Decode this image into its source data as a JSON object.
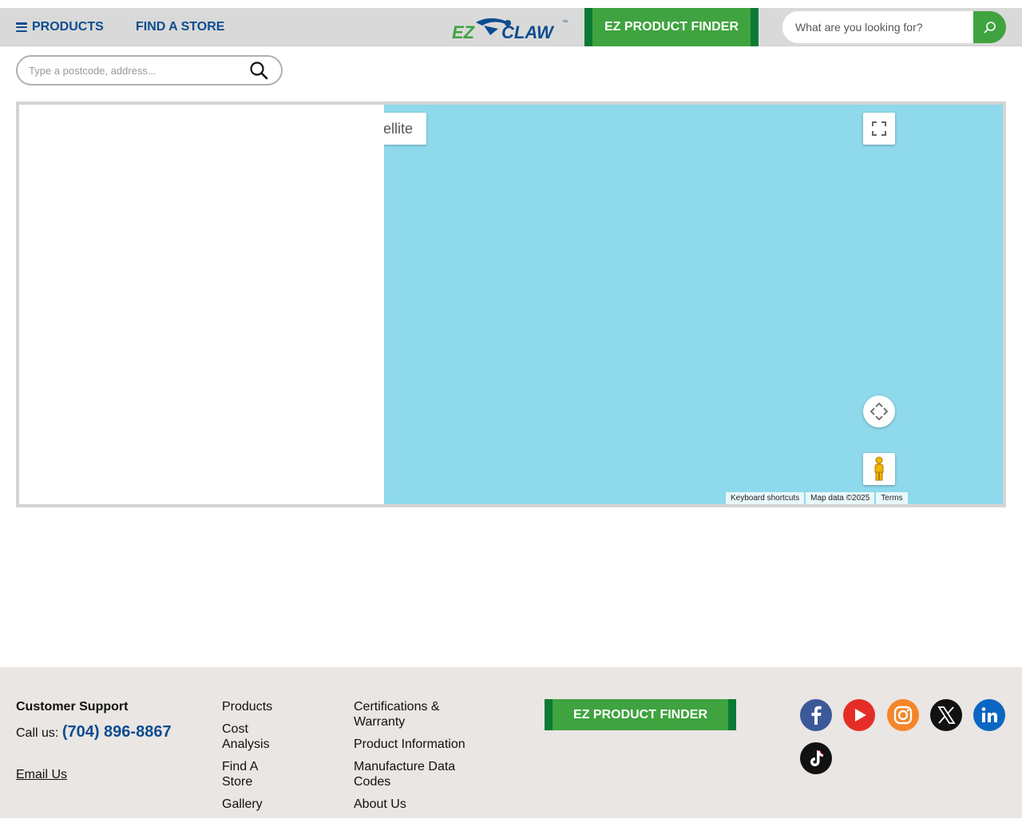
{
  "header": {
    "products_label": "PRODUCTS",
    "find_store_label": "FIND A STORE",
    "logo_ez": "EZ",
    "logo_claw": "CLAW",
    "logo_tm": "™",
    "finder_label": "EZ PRODUCT FINDER",
    "search_placeholder": "What are you looking for?"
  },
  "locator": {
    "search_placeholder": "Type a postcode, address..."
  },
  "map": {
    "map_type_label": "ellite",
    "attribution": {
      "shortcuts": "Keyboard shortcuts",
      "data": "Map data ©2025",
      "terms": "Terms"
    },
    "water_color": "#8fd9ec"
  },
  "footer": {
    "support_title": "Customer Support",
    "call_prefix": "Call us:",
    "phone": "(704) 896-8867",
    "email_label": "Email Us",
    "col1": [
      "Products",
      "Cost Analysis",
      "Find A Store",
      "Gallery"
    ],
    "col2": [
      "Certifications & Warranty",
      "Product Information",
      "Manufacture Data Codes",
      "About Us"
    ],
    "finder_label": "EZ PRODUCT FINDER",
    "social": [
      "facebook-icon",
      "youtube-icon",
      "instagram-icon",
      "x-twitter-icon",
      "linkedin-icon",
      "tiktok-icon"
    ]
  },
  "colors": {
    "brand_blue": "#0d4c8f",
    "brand_green": "#3fa33f",
    "brand_dark_green": "#0b7a35",
    "footer_bg": "#e9e6e3"
  }
}
